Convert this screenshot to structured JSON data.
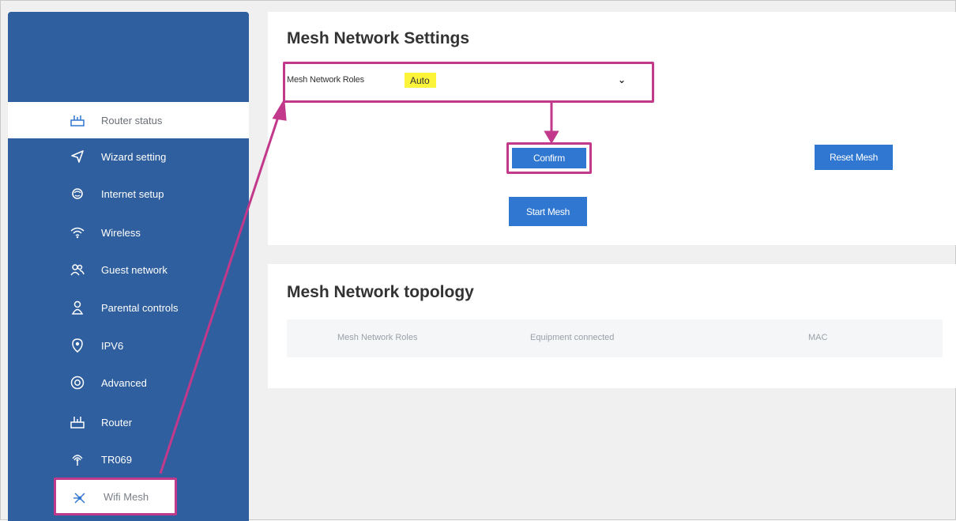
{
  "sidebar": {
    "items": [
      {
        "label": "Router status",
        "icon": "router-status-icon"
      },
      {
        "label": "Wizard setting",
        "icon": "send-icon"
      },
      {
        "label": "Internet setup",
        "icon": "globe-icon"
      },
      {
        "label": "Wireless",
        "icon": "wifi-icon"
      },
      {
        "label": "Guest network",
        "icon": "guest-users-icon"
      },
      {
        "label": "Parental controls",
        "icon": "parental-icon"
      },
      {
        "label": "IPV6",
        "icon": "ipv6-icon"
      },
      {
        "label": "Advanced",
        "icon": "advanced-icon"
      },
      {
        "label": "Router",
        "icon": "router-icon"
      },
      {
        "label": "TR069",
        "icon": "tr069-icon"
      },
      {
        "label": "Wifi Mesh",
        "icon": "wifi-mesh-icon"
      }
    ]
  },
  "settings": {
    "title": "Mesh Network Settings",
    "roles_label": "Mesh Network Roles",
    "roles_value": "Auto",
    "confirm_label": "Confirm",
    "reset_label": "Reset Mesh",
    "start_label": "Start Mesh"
  },
  "topology": {
    "title": "Mesh Network topology",
    "columns": [
      "Mesh Network Roles",
      "Equipment connected",
      "MAC"
    ]
  },
  "colors": {
    "sidebar": "#2f5f9e",
    "button": "#2f77d0",
    "annotation": "#c2388a",
    "highlight": "#fbf43a"
  }
}
